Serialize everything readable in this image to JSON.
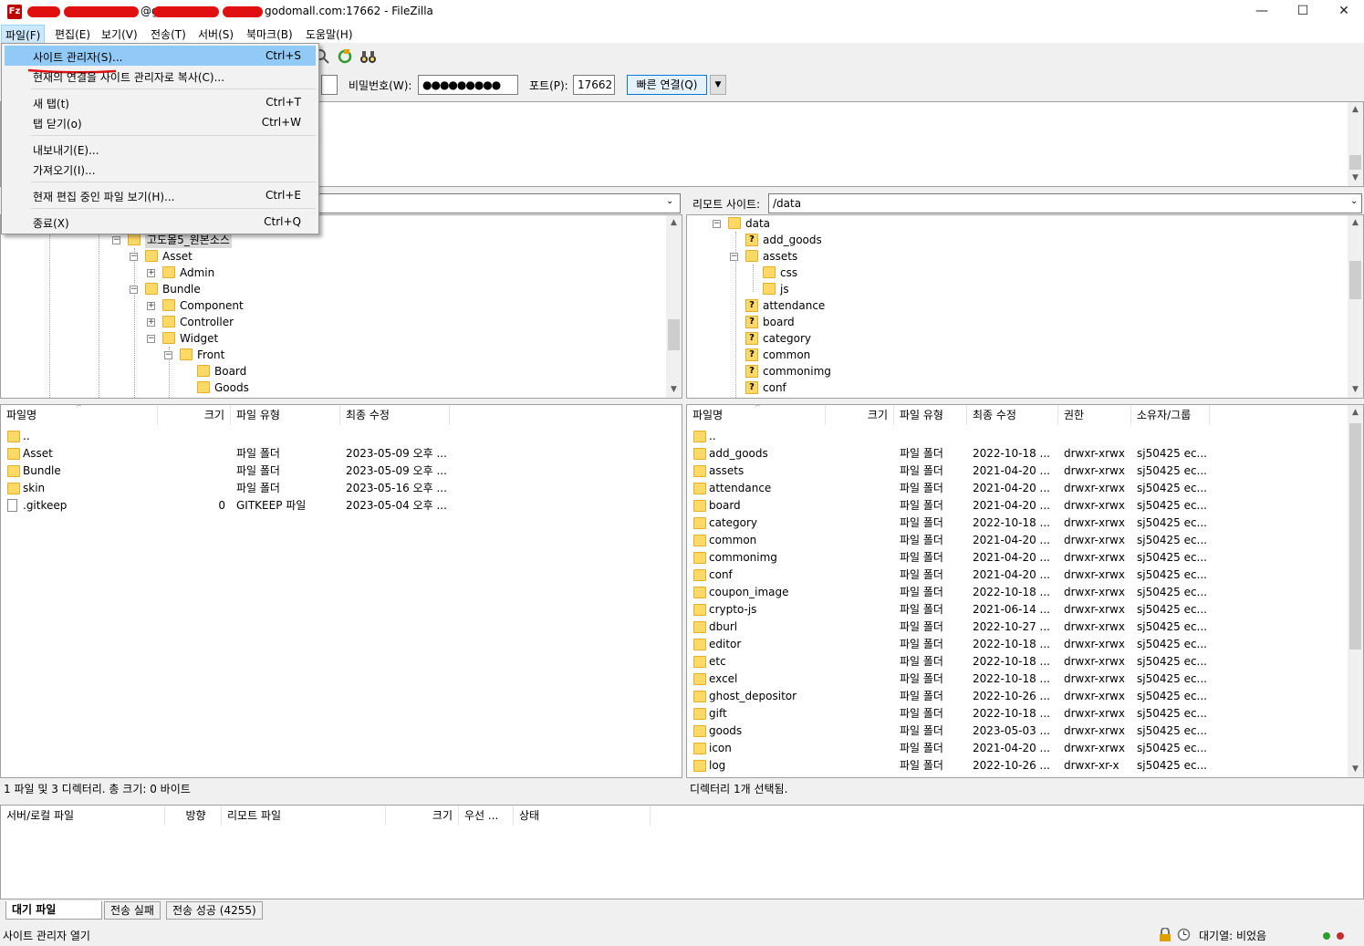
{
  "window": {
    "title_suffix": "@g",
    "title_host": "godomall.com:17662 - FileZilla",
    "app_icon": "Fz",
    "minimize": "—",
    "maximize": "☐",
    "close": "✕"
  },
  "menubar": {
    "items": [
      "파일(F)",
      "편집(E)",
      "보기(V)",
      "전송(T)",
      "서버(S)",
      "북마크(B)",
      "도움말(H)"
    ]
  },
  "file_menu": {
    "items": [
      {
        "label": "사이트 관리자(S)...",
        "shortcut": "Ctrl+S"
      },
      {
        "label": "현재의 연결을 사이트 관리자로 복사(C)...",
        "shortcut": ""
      },
      {
        "label": "새 탭(t)",
        "shortcut": "Ctrl+T"
      },
      {
        "label": "탭 닫기(o)",
        "shortcut": "Ctrl+W"
      },
      {
        "label": "내보내기(E)...",
        "shortcut": ""
      },
      {
        "label": "가져오기(I)...",
        "shortcut": ""
      },
      {
        "label": "현재 편집 중인 파일 보기(H)...",
        "shortcut": "Ctrl+E"
      },
      {
        "label": "종료(X)",
        "shortcut": "Ctrl+Q"
      }
    ]
  },
  "quickconnect": {
    "password_label": "비밀번호(W):",
    "password_value": "●●●●●●●●●",
    "port_label": "포트(P):",
    "port_value": "17662",
    "connect_button": "빠른 연결(Q)",
    "dropdown": "▼"
  },
  "local_site": {
    "tree": [
      {
        "label": "고도몰5_원본소스"
      },
      {
        "label": "Asset"
      },
      {
        "label": "Admin"
      },
      {
        "label": "Bundle"
      },
      {
        "label": "Component"
      },
      {
        "label": "Controller"
      },
      {
        "label": "Widget"
      },
      {
        "label": "Front"
      },
      {
        "label": "Board"
      },
      {
        "label": "Goods"
      }
    ],
    "columns": [
      "파일명",
      "크기",
      "파일 유형",
      "최종 수정"
    ],
    "files": [
      {
        "name": "..",
        "size": "",
        "type": "",
        "modified": ""
      },
      {
        "name": "Asset",
        "size": "",
        "type": "파일 폴더",
        "modified": "2023-05-09 오후 ..."
      },
      {
        "name": "Bundle",
        "size": "",
        "type": "파일 폴더",
        "modified": "2023-05-09 오후 ..."
      },
      {
        "name": "skin",
        "size": "",
        "type": "파일 폴더",
        "modified": "2023-05-16 오후 ..."
      },
      {
        "name": ".gitkeep",
        "size": "0",
        "type": "GITKEEP 파일",
        "modified": "2023-05-04 오후 ..."
      }
    ],
    "status": "1 파일 및 3 디렉터리. 총 크기: 0 바이트"
  },
  "remote_site": {
    "label": "리모트 사이트:",
    "path": "/data",
    "tree": [
      {
        "label": "data"
      },
      {
        "label": "add_goods"
      },
      {
        "label": "assets"
      },
      {
        "label": "css"
      },
      {
        "label": "js"
      },
      {
        "label": "attendance"
      },
      {
        "label": "board"
      },
      {
        "label": "category"
      },
      {
        "label": "common"
      },
      {
        "label": "commonimg"
      },
      {
        "label": "conf"
      }
    ],
    "columns": [
      "파일명",
      "크기",
      "파일 유형",
      "최종 수정",
      "권한",
      "소유자/그룹"
    ],
    "files": [
      {
        "name": "..",
        "type": "",
        "modified": "",
        "perm": "",
        "owner": ""
      },
      {
        "name": "add_goods",
        "type": "파일 폴더",
        "modified": "2022-10-18 ...",
        "perm": "drwxr-xrwx",
        "owner": "sj50425 ec..."
      },
      {
        "name": "assets",
        "type": "파일 폴더",
        "modified": "2021-04-20 ...",
        "perm": "drwxr-xrwx",
        "owner": "sj50425 ec..."
      },
      {
        "name": "attendance",
        "type": "파일 폴더",
        "modified": "2021-04-20 ...",
        "perm": "drwxr-xrwx",
        "owner": "sj50425 ec..."
      },
      {
        "name": "board",
        "type": "파일 폴더",
        "modified": "2021-04-20 ...",
        "perm": "drwxr-xrwx",
        "owner": "sj50425 ec..."
      },
      {
        "name": "category",
        "type": "파일 폴더",
        "modified": "2022-10-18 ...",
        "perm": "drwxr-xrwx",
        "owner": "sj50425 ec..."
      },
      {
        "name": "common",
        "type": "파일 폴더",
        "modified": "2021-04-20 ...",
        "perm": "drwxr-xrwx",
        "owner": "sj50425 ec..."
      },
      {
        "name": "commonimg",
        "type": "파일 폴더",
        "modified": "2021-04-20 ...",
        "perm": "drwxr-xrwx",
        "owner": "sj50425 ec..."
      },
      {
        "name": "conf",
        "type": "파일 폴더",
        "modified": "2021-04-20 ...",
        "perm": "drwxr-xrwx",
        "owner": "sj50425 ec..."
      },
      {
        "name": "coupon_image",
        "type": "파일 폴더",
        "modified": "2022-10-18 ...",
        "perm": "drwxr-xrwx",
        "owner": "sj50425 ec..."
      },
      {
        "name": "crypto-js",
        "type": "파일 폴더",
        "modified": "2021-06-14 ...",
        "perm": "drwxr-xrwx",
        "owner": "sj50425 ec..."
      },
      {
        "name": "dburl",
        "type": "파일 폴더",
        "modified": "2022-10-27 ...",
        "perm": "drwxr-xrwx",
        "owner": "sj50425 ec..."
      },
      {
        "name": "editor",
        "type": "파일 폴더",
        "modified": "2022-10-18 ...",
        "perm": "drwxr-xrwx",
        "owner": "sj50425 ec..."
      },
      {
        "name": "etc",
        "type": "파일 폴더",
        "modified": "2022-10-18 ...",
        "perm": "drwxr-xrwx",
        "owner": "sj50425 ec..."
      },
      {
        "name": "excel",
        "type": "파일 폴더",
        "modified": "2022-10-18 ...",
        "perm": "drwxr-xrwx",
        "owner": "sj50425 ec..."
      },
      {
        "name": "ghost_depositor",
        "type": "파일 폴더",
        "modified": "2022-10-26 ...",
        "perm": "drwxr-xrwx",
        "owner": "sj50425 ec..."
      },
      {
        "name": "gift",
        "type": "파일 폴더",
        "modified": "2022-10-18 ...",
        "perm": "drwxr-xrwx",
        "owner": "sj50425 ec..."
      },
      {
        "name": "goods",
        "type": "파일 폴더",
        "modified": "2023-05-03 ...",
        "perm": "drwxr-xrwx",
        "owner": "sj50425 ec..."
      },
      {
        "name": "icon",
        "type": "파일 폴더",
        "modified": "2021-04-20 ...",
        "perm": "drwxr-xrwx",
        "owner": "sj50425 ec..."
      },
      {
        "name": "log",
        "type": "파일 폴더",
        "modified": "2022-10-26 ...",
        "perm": "drwxr-xr-x",
        "owner": "sj50425 ec..."
      }
    ],
    "status": "디렉터리 1개 선택됨."
  },
  "queue": {
    "columns": [
      "서버/로컬 파일",
      "방향",
      "리모트 파일",
      "크기",
      "우선 ...",
      "상태"
    ],
    "tabs": [
      "대기 파일",
      "전송 실패",
      "전송 성공 (4255)"
    ]
  },
  "statusbar": {
    "left": "사이트 관리자 열기",
    "queue": "대기열: 비었음"
  },
  "colors": {
    "menu_highlight": "#91c9f7",
    "folder": "#ffd966",
    "annotation_underline": "#e01010"
  },
  "icons": [
    "filezilla-icon",
    "search-icon",
    "refresh-icon",
    "binoculars-icon",
    "lock-icon",
    "clock-icon",
    "status-light-icon"
  ]
}
